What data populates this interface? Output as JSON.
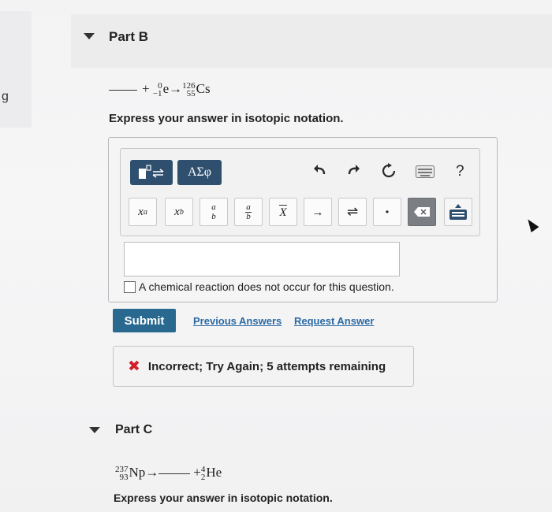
{
  "sidebar_fragment": "g",
  "part_b": {
    "title": "Part B",
    "equation": {
      "plus": "+",
      "electron_mass": "0",
      "electron_charge": "−1",
      "electron_symbol": "e",
      "arrow": "→",
      "product_mass": "126",
      "product_atomic": "55",
      "product_symbol": "Cs"
    },
    "prompt": "Express your answer in isotopic notation."
  },
  "editor": {
    "template_button_icon": "template-icon",
    "greek_button_label": "ΑΣφ",
    "undo_icon": "undo-icon",
    "redo_icon": "redo-icon",
    "reset_icon": "reset-icon",
    "keyboard_icon": "keyboard-icon",
    "help_label": "?",
    "keys": {
      "superscript_base": "x",
      "superscript_exp": "a",
      "subscript_base": "x",
      "subscript_sub": "b",
      "stack_top": "a",
      "stack_bottom": "b",
      "fraction_top": "a",
      "fraction_bottom": "b",
      "overline_char": "X",
      "reaction_arrow": "→",
      "equilibrium_arrow": "⇌",
      "dot": "•"
    },
    "answer_value": "",
    "no_reaction_label": "A chemical reaction does not occur for this question."
  },
  "actions": {
    "submit_label": "Submit",
    "previous_answers": "Previous Answers",
    "request_answer": "Request Answer"
  },
  "feedback": {
    "text": "Incorrect; Try Again; 5 attempts remaining"
  },
  "part_c": {
    "title": "Part C",
    "equation": {
      "reactant_mass": "237",
      "reactant_atomic": "93",
      "reactant_symbol": "Np",
      "arrow": "→",
      "plus": "+",
      "he_mass": "4",
      "he_atomic": "2",
      "he_symbol": "He"
    },
    "prompt": "Express your answer in isotopic notation."
  },
  "colors": {
    "primary": "#2f4f6f",
    "submit": "#29698f",
    "link": "#2a6aa4",
    "error": "#d0202a"
  }
}
